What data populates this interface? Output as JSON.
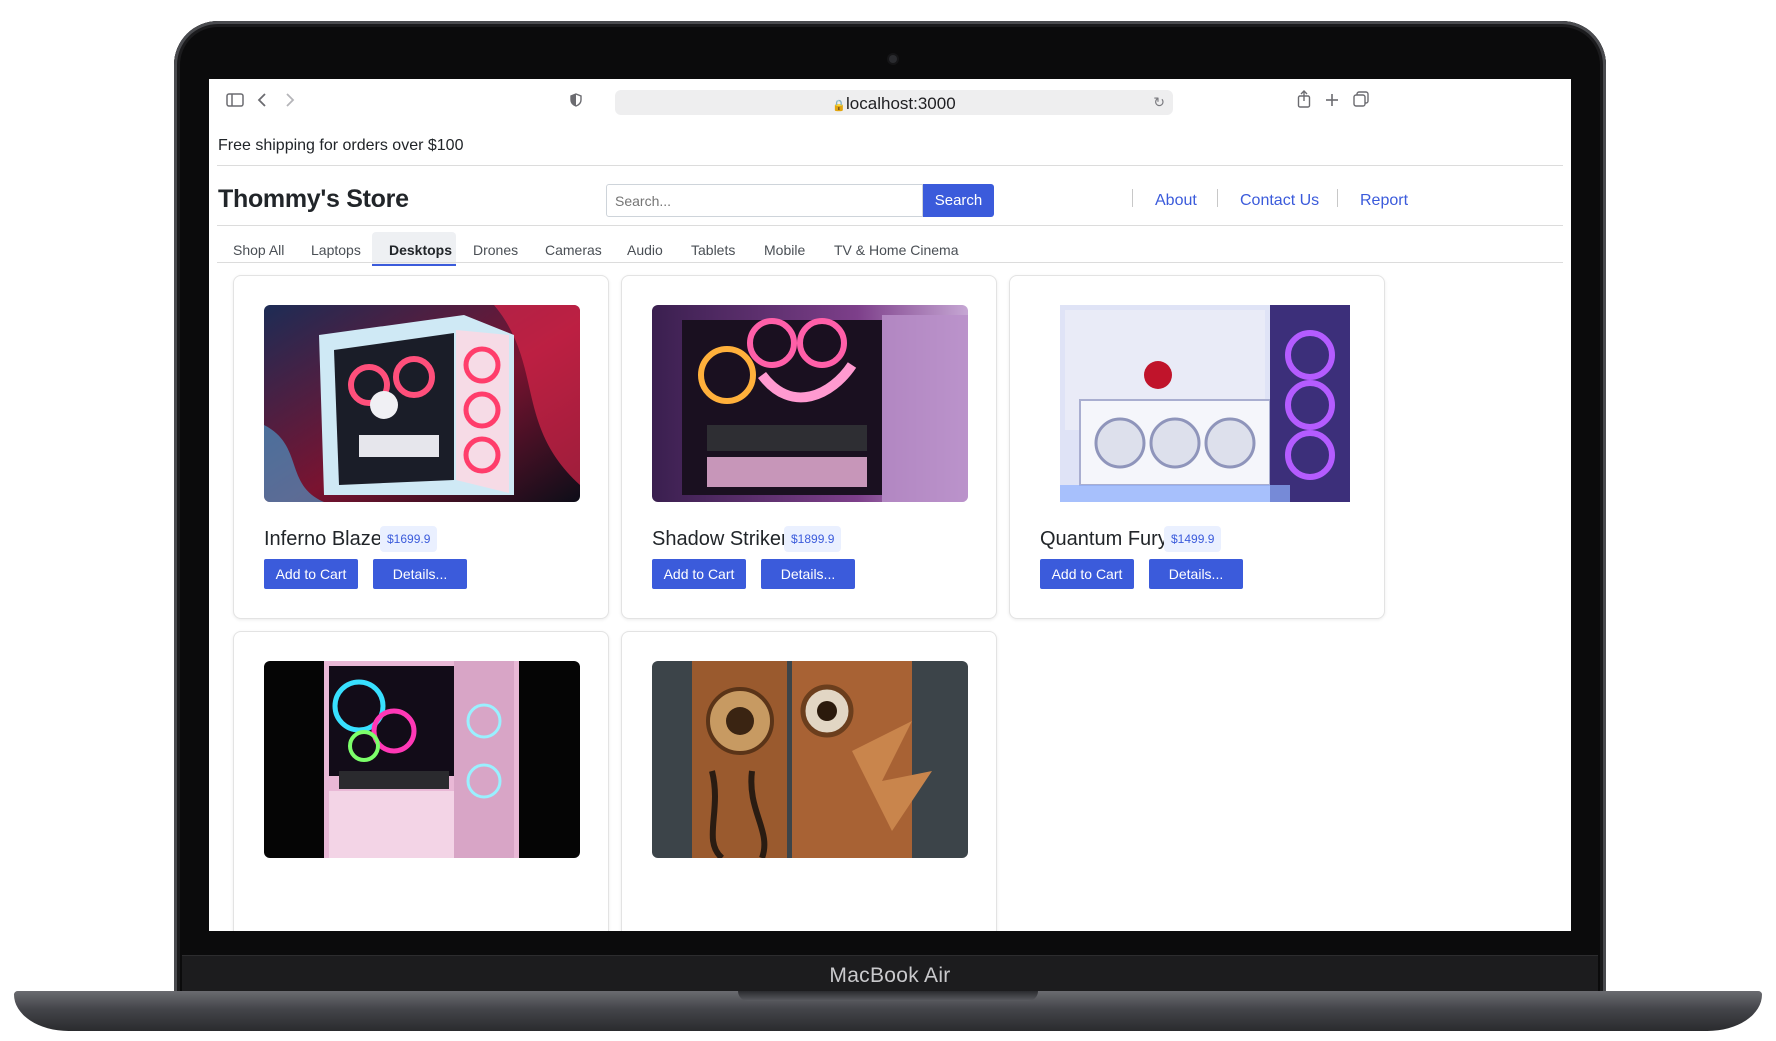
{
  "device": {
    "label": "MacBook Air"
  },
  "browser": {
    "url": "localhost:3000",
    "icons": [
      "sidebar-icon",
      "back-icon",
      "forward-icon",
      "shield-icon",
      "lock-icon",
      "reload-icon",
      "share-icon",
      "new-tab-icon",
      "tabs-icon"
    ]
  },
  "promo": {
    "text": "Free shipping for orders over $100"
  },
  "header": {
    "brand": "Thommy's Store",
    "search_placeholder": "Search...",
    "search_button": "Search",
    "links": [
      "About",
      "Contact Us",
      "Report"
    ]
  },
  "categories": {
    "active": "Desktops",
    "items": [
      "Shop All",
      "Laptops",
      "Desktops",
      "Drones",
      "Cameras",
      "Audio",
      "Tablets",
      "Mobile",
      "TV & Home Cinema"
    ]
  },
  "products": [
    {
      "name": "Inferno Blaze",
      "price": "$1699.9",
      "add_label": "Add to Cart",
      "details_label": "Details..."
    },
    {
      "name": "Shadow Striker",
      "price": "$1899.9",
      "add_label": "Add to Cart",
      "details_label": "Details..."
    },
    {
      "name": "Quantum Fury",
      "price": "$1499.9",
      "add_label": "Add to Cart",
      "details_label": "Details..."
    },
    {
      "name": "",
      "price": ""
    },
    {
      "name": "",
      "price": ""
    }
  ],
  "colors": {
    "accent": "#3b5bdb",
    "price_bg": "#eaf0ff",
    "text": "#212529"
  }
}
